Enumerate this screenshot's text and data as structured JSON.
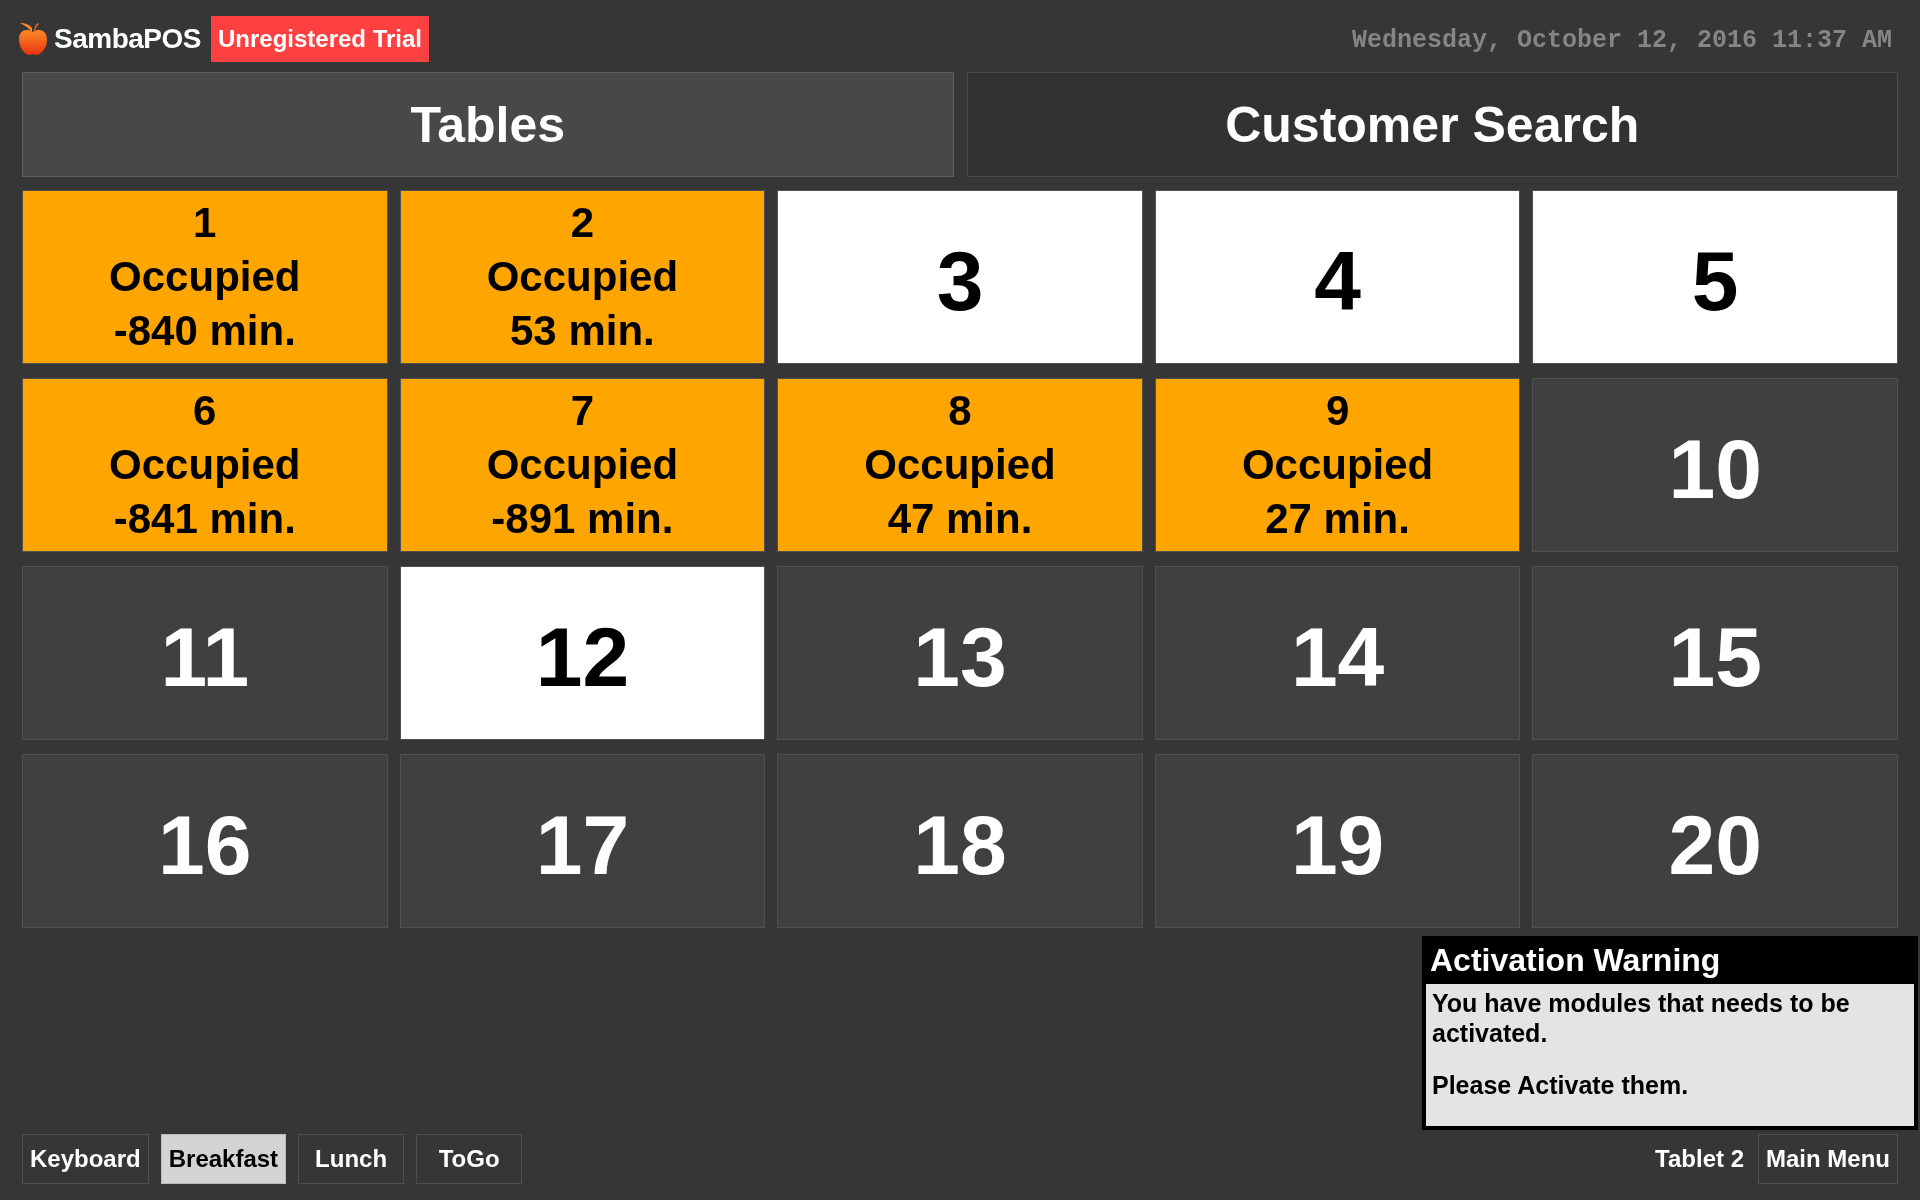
{
  "header": {
    "app_name": "SambaPOS",
    "badge": "Unregistered Trial",
    "datetime": "Wednesday, October 12, 2016 11:37 AM"
  },
  "tabs": [
    {
      "label": "Tables",
      "selected": true
    },
    {
      "label": "Customer Search",
      "selected": false
    }
  ],
  "tables": [
    {
      "number": "1",
      "color": "#ffa500",
      "status": "Occupied",
      "duration": "-840 min."
    },
    {
      "number": "2",
      "color": "#ffa500",
      "status": "Occupied",
      "duration": "53 min."
    },
    {
      "number": "3",
      "color": "#ffffff"
    },
    {
      "number": "4",
      "color": "#ffffff"
    },
    {
      "number": "5",
      "color": "#ffffff"
    },
    {
      "number": "6",
      "color": "#ffa500",
      "status": "Occupied",
      "duration": "-841 min."
    },
    {
      "number": "7",
      "color": "#ffa500",
      "status": "Occupied",
      "duration": "-891 min."
    },
    {
      "number": "8",
      "color": "#ffa500",
      "status": "Occupied",
      "duration": "47 min."
    },
    {
      "number": "9",
      "color": "#ffa500",
      "status": "Occupied",
      "duration": "27 min."
    },
    {
      "number": "10",
      "color": "#404040"
    },
    {
      "number": "11",
      "color": "#404040"
    },
    {
      "number": "12",
      "color": "#ffffff"
    },
    {
      "number": "13",
      "color": "#404040"
    },
    {
      "number": "14",
      "color": "#404040"
    },
    {
      "number": "15",
      "color": "#404040"
    },
    {
      "number": "16",
      "color": "#404040"
    },
    {
      "number": "17",
      "color": "#404040"
    },
    {
      "number": "18",
      "color": "#404040"
    },
    {
      "number": "19",
      "color": "#404040"
    },
    {
      "number": "20",
      "color": "#404040"
    }
  ],
  "bottom_bar": {
    "buttons": [
      {
        "label": "Keyboard",
        "selected": false
      },
      {
        "label": "Breakfast",
        "selected": true
      },
      {
        "label": "Lunch",
        "selected": false
      },
      {
        "label": "ToGo",
        "selected": false
      }
    ],
    "terminal": "Tablet 2",
    "main_menu": "Main Menu"
  },
  "popup": {
    "title": "Activation Warning",
    "paragraphs": [
      "You have modules that needs to be activated.",
      "Please Activate them."
    ]
  }
}
